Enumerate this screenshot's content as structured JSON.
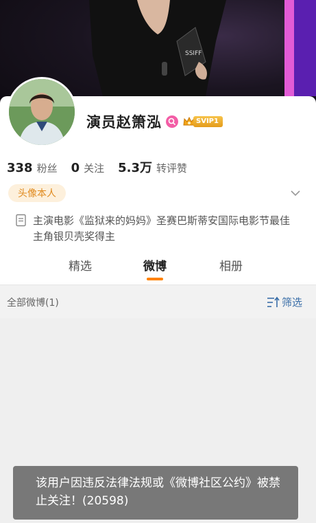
{
  "profile": {
    "name": "演员赵箫泓",
    "badge_svip": "SVIP1",
    "tag": "头像本人",
    "bio": "主演电影《监狱来的妈妈》圣赛巴斯蒂安国际电影节最佳主角银贝壳奖得主"
  },
  "stats": [
    {
      "num": "338",
      "label": "粉丝"
    },
    {
      "num": "0",
      "label": "关注"
    },
    {
      "num": "5.3万",
      "label": "转评赞"
    }
  ],
  "tabs": [
    {
      "label": "精选",
      "active": false
    },
    {
      "label": "微博",
      "active": true
    },
    {
      "label": "相册",
      "active": false
    }
  ],
  "feed": {
    "all_label": "全部微博(1)",
    "filter_label": "筛选"
  },
  "toast": {
    "text": "该用户因违反法律法规或《微博社区公约》被禁止关注！(20598)"
  },
  "colors": {
    "accent": "#ff8200",
    "tag_bg": "#fdf0dc",
    "tag_fg": "#e08a1e",
    "link": "#3a6ea8",
    "verify": "#f35da6"
  },
  "icons": {
    "verify": "verified-badge-icon",
    "svip": "crown-icon",
    "chevron": "chevron-down-icon",
    "bio": "document-icon",
    "filter": "filter-icon"
  }
}
